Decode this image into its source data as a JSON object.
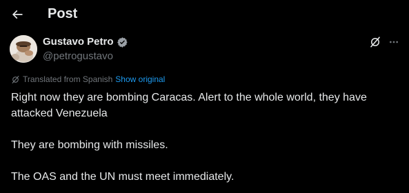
{
  "header": {
    "title": "Post"
  },
  "author": {
    "name": "Gustavo Petro",
    "handle": "@petrogustavo",
    "verified": true
  },
  "translation": {
    "label": "Translated from Spanish",
    "show_original": "Show original"
  },
  "post": {
    "paragraphs": [
      "Right now they are bombing Caracas. Alert to the whole world, they have attacked Venezuela",
      "They are bombing with missiles.",
      "The OAS and the UN must meet immediately."
    ]
  },
  "colors": {
    "background": "#000000",
    "text": "#e7e9ea",
    "secondary": "#71767b",
    "accent": "#1d9bf0"
  },
  "icons": {
    "back": "arrow-left-icon",
    "verified": "verified-badge-icon",
    "grok": "grok-icon",
    "more": "more-horizontal-icon",
    "translate": "translate-icon"
  }
}
